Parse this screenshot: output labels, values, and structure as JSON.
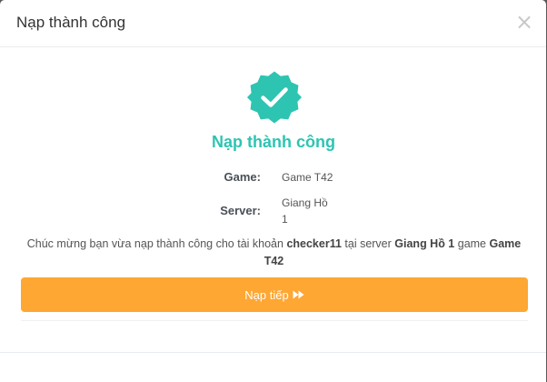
{
  "modal": {
    "title": "Nạp thành công",
    "close_label": "×"
  },
  "result": {
    "icon": "check-badge-icon",
    "heading": "Nạp thành công",
    "accent_color": "#2ec4b2"
  },
  "details": {
    "game_label": "Game:",
    "game_value": "Game T42",
    "server_label": "Server:",
    "server_value": "Giang Hồ 1"
  },
  "message": {
    "prefix": "Chúc mừng bạn vừa nạp thành công cho tài khoản ",
    "account": "checker11",
    "middle": " tại server ",
    "server": "Giang Hồ 1",
    "suffix": " game ",
    "game": "Game T42"
  },
  "actions": {
    "continue_label": "Nạp tiếp",
    "continue_icon": "fast-forward-icon",
    "button_color": "#fea733"
  }
}
